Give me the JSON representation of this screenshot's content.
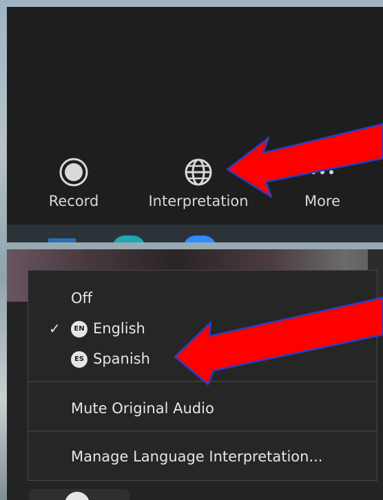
{
  "toolbar": {
    "record_label": "Record",
    "interpretation_label": "Interpretation",
    "more_label": "More"
  },
  "menu": {
    "off_label": "Off",
    "languages": [
      {
        "badge": "EN",
        "label": "English",
        "checked": true,
        "check_mark": "✓"
      },
      {
        "badge": "ES",
        "label": "Spanish",
        "checked": false
      }
    ],
    "mute_label": "Mute Original Audio",
    "manage_label": "Manage Language Interpretation..."
  },
  "colors": {
    "arrow_fill": "#ff0000",
    "arrow_outline": "#2a3fbf",
    "panel_bg": "#1e1e1e"
  }
}
